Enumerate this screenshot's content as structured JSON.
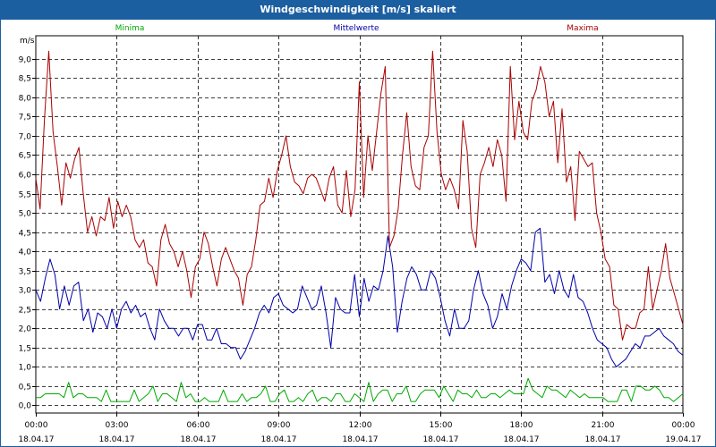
{
  "window": {
    "title": "Windgeschwindigkeit [m/s] skaliert"
  },
  "colors": {
    "minima": "#00aa00",
    "mittel": "#0000aa",
    "maxima": "#aa0000",
    "grid": "#000000"
  },
  "chart_data": {
    "type": "line",
    "title": "Windgeschwindigkeit [m/s] skaliert",
    "ylabel": "m/s",
    "ylim": [
      -0.2,
      9.6
    ],
    "xlim": [
      0,
      24
    ],
    "grid": true,
    "legend_position": "top",
    "yticks": [
      "0,0",
      "0,5",
      "1,0",
      "1,5",
      "2,0",
      "2,5",
      "3,0",
      "3,5",
      "4,0",
      "4,5",
      "5,0",
      "5,5",
      "6,0",
      "6,5",
      "7,0",
      "7,5",
      "8,0",
      "8,5",
      "9,0"
    ],
    "xticks": [
      {
        "time": "00:00",
        "date": "18.04.17"
      },
      {
        "time": "03:00",
        "date": "18.04.17"
      },
      {
        "time": "06:00",
        "date": "18.04.17"
      },
      {
        "time": "09:00",
        "date": "18.04.17"
      },
      {
        "time": "12:00",
        "date": "18.04.17"
      },
      {
        "time": "15:00",
        "date": "18.04.17"
      },
      {
        "time": "18:00",
        "date": "18.04.17"
      },
      {
        "time": "21:00",
        "date": "18.04.17"
      },
      {
        "time": "00:00",
        "date": "19.04.17"
      }
    ],
    "series": [
      {
        "name": "Maxima",
        "values": [
          5.9,
          5.1,
          7.4,
          9.2,
          7.1,
          6.2,
          5.2,
          6.3,
          5.9,
          6.4,
          6.7,
          5.5,
          4.5,
          4.9,
          4.4,
          4.9,
          4.8,
          5.4,
          4.6,
          5.3,
          4.9,
          5.2,
          4.9,
          4.3,
          4.1,
          4.3,
          3.7,
          3.6,
          3.1,
          4.3,
          4.7,
          4.2,
          4.0,
          3.6,
          4.0,
          3.5,
          2.8,
          3.6,
          3.8,
          4.5,
          4.2,
          3.6,
          3.1,
          3.8,
          4.1,
          3.8,
          3.5,
          3.3,
          2.6,
          3.4,
          3.6,
          4.3,
          5.2,
          5.3,
          5.9,
          5.4,
          6.1,
          6.5,
          7.0,
          6.2,
          5.8,
          5.7,
          5.5,
          5.9,
          6.0,
          5.9,
          5.6,
          5.3,
          5.9,
          6.2,
          5.2,
          5.0,
          6.1,
          4.9,
          5.6,
          8.4,
          5.4,
          7.0,
          6.1,
          7.1,
          8.1,
          8.8,
          4.1,
          4.4,
          5.1,
          6.5,
          7.6,
          6.2,
          5.7,
          5.6,
          6.7,
          7.0,
          9.2,
          7.1,
          6.0,
          5.6,
          5.9,
          5.6,
          5.1,
          7.4,
          6.6,
          4.6,
          4.1,
          6.0,
          6.3,
          6.7,
          6.2,
          6.9,
          6.5,
          5.3,
          8.8,
          6.9,
          7.9,
          7.1,
          6.9,
          7.9,
          8.2,
          8.8,
          8.4,
          7.5,
          7.9,
          6.3,
          7.7,
          5.8,
          6.2,
          4.8,
          6.6,
          6.4,
          6.2,
          6.3,
          5.0,
          4.5,
          3.8,
          3.6,
          2.6,
          2.5,
          1.7,
          2.1,
          2.0,
          2.0,
          2.4,
          2.5,
          3.6,
          2.5,
          3.0,
          3.5,
          4.2,
          3.3,
          2.9,
          2.5,
          2.1
        ]
      },
      {
        "name": "Mittelwerte",
        "values": [
          3.0,
          2.7,
          3.3,
          3.8,
          3.4,
          2.5,
          3.1,
          2.6,
          3.1,
          3.2,
          2.2,
          2.5,
          1.9,
          2.4,
          2.3,
          2.0,
          2.5,
          2.0,
          2.5,
          2.7,
          2.4,
          2.6,
          2.3,
          2.4,
          2.0,
          1.7,
          2.5,
          2.2,
          2.0,
          2.0,
          1.8,
          2.0,
          2.0,
          1.7,
          2.1,
          2.1,
          1.7,
          1.7,
          2.0,
          1.6,
          1.6,
          1.5,
          1.5,
          1.2,
          1.4,
          1.7,
          2.0,
          2.4,
          2.6,
          2.4,
          2.8,
          2.9,
          2.6,
          2.5,
          2.4,
          2.5,
          3.1,
          2.8,
          2.5,
          2.6,
          3.1,
          2.4,
          1.5,
          2.8,
          2.5,
          2.4,
          2.4,
          3.4,
          2.3,
          3.3,
          2.7,
          3.1,
          3.0,
          3.5,
          4.4,
          3.6,
          1.9,
          2.7,
          3.3,
          3.6,
          3.4,
          3.0,
          3.0,
          3.5,
          3.3,
          2.8,
          2.2,
          1.8,
          2.5,
          2.0,
          2.0,
          2.2,
          3.0,
          3.5,
          2.9,
          2.6,
          2.0,
          2.3,
          2.9,
          2.5,
          3.1,
          3.5,
          3.8,
          3.7,
          3.5,
          4.5,
          4.6,
          3.2,
          3.4,
          2.9,
          3.5,
          3.0,
          2.8,
          3.4,
          2.8,
          2.7,
          2.4,
          2.0,
          1.7,
          1.6,
          1.5,
          1.2,
          1.0,
          1.1,
          1.2,
          1.4,
          1.6,
          1.5,
          1.8,
          1.8,
          1.9,
          2.0,
          1.8,
          1.7,
          1.6,
          1.4,
          1.3
        ]
      },
      {
        "name": "Minima",
        "values": [
          0.2,
          0.2,
          0.3,
          0.3,
          0.3,
          0.3,
          0.2,
          0.6,
          0.2,
          0.3,
          0.3,
          0.2,
          0.2,
          0.2,
          0.1,
          0.4,
          0.1,
          0.1,
          0.1,
          0.1,
          0.1,
          0.4,
          0.1,
          0.2,
          0.3,
          0.5,
          0.1,
          0.3,
          0.3,
          0.2,
          0.1,
          0.6,
          0.2,
          0.3,
          0.1,
          0.1,
          0.2,
          0.1,
          0.1,
          0.1,
          0.4,
          0.1,
          0.1,
          0.1,
          0.3,
          0.1,
          0.2,
          0.2,
          0.3,
          0.5,
          0.1,
          0.1,
          0.3,
          0.4,
          0.1,
          0.1,
          0.2,
          0.1,
          0.3,
          0.4,
          0.1,
          0.2,
          0.2,
          0.1,
          0.3,
          0.3,
          0.1,
          0.1,
          0.3,
          0.2,
          0.1,
          0.6,
          0.1,
          0.3,
          0.4,
          0.4,
          0.1,
          0.3,
          0.3,
          0.5,
          0.1,
          0.1,
          0.3,
          0.4,
          0.4,
          0.4,
          0.2,
          0.5,
          0.3,
          0.1,
          0.4,
          0.3,
          0.3,
          0.2,
          0.4,
          0.2,
          0.2,
          0.3,
          0.3,
          0.2,
          0.3,
          0.4,
          0.3,
          0.3,
          0.3,
          0.7,
          0.4,
          0.3,
          0.2,
          0.5,
          0.4,
          0.4,
          0.3,
          0.2,
          0.4,
          0.3,
          0.2,
          0.3,
          0.2,
          0.2,
          0.2,
          0.2,
          0.1,
          0.1,
          0.1,
          0.4,
          0.4,
          0.1,
          0.5,
          0.5,
          0.4,
          0.4,
          0.5,
          0.4,
          0.2,
          0.2,
          0.1,
          0.2,
          0.3
        ]
      }
    ]
  }
}
